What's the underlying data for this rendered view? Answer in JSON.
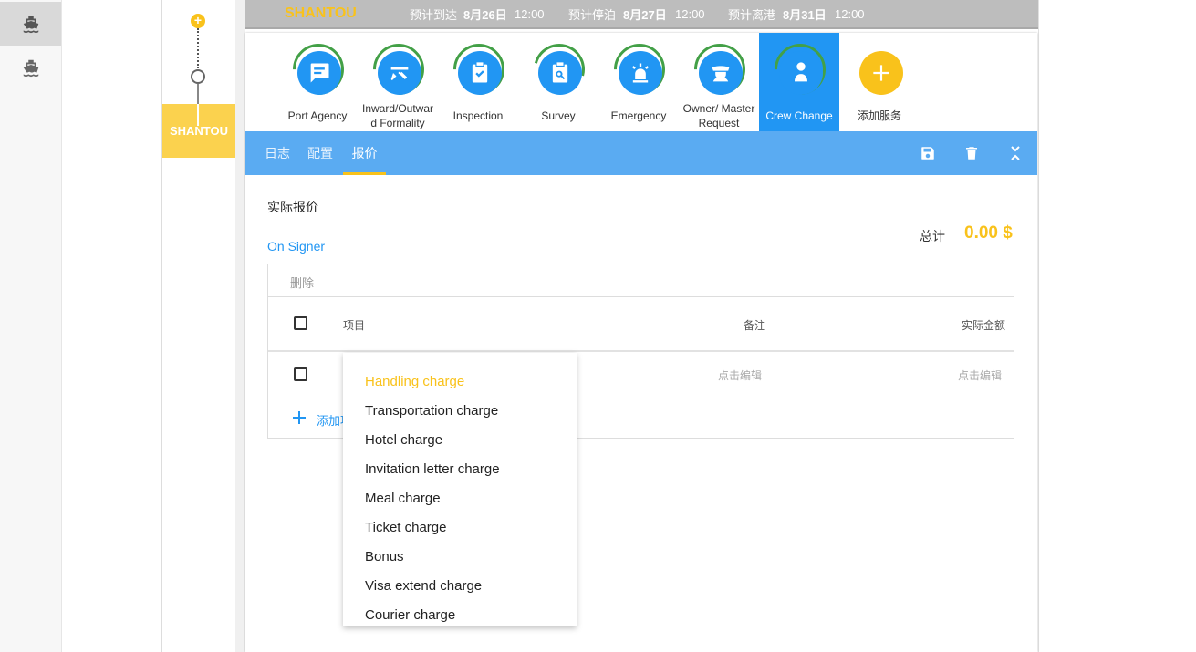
{
  "port_name": "SHANTOU",
  "eta": {
    "label": "预计到达",
    "date": "8月26日",
    "time": "12:00"
  },
  "etb": {
    "label": "预计停泊",
    "date": "8月27日",
    "time": "12:00"
  },
  "etd": {
    "label": "预计离港",
    "date": "8月31日",
    "time": "12:00"
  },
  "timeline_port": "SHANTOU",
  "services": [
    {
      "label": "Port Agency",
      "icon": "chat-list-icon"
    },
    {
      "label": "Inward/Outward Formality",
      "label_l1": "Inward/Outwar",
      "label_l2": "d Formality",
      "icon": "tools-icon"
    },
    {
      "label": "Inspection",
      "icon": "clipboard-check-icon"
    },
    {
      "label": "Survey",
      "icon": "clipboard-search-icon"
    },
    {
      "label": "Emergency",
      "icon": "siren-icon"
    },
    {
      "label": "Owner/ Master Request",
      "label_l1": "Owner/ Master",
      "label_l2": "Request",
      "icon": "captain-icon"
    },
    {
      "label": "Crew Change",
      "icon": "crew-change-icon"
    },
    {
      "label": "添加服务",
      "icon": "plus-icon"
    }
  ],
  "tabs": [
    "日志",
    "配置",
    "报价"
  ],
  "active_tab": "报价",
  "colors": {
    "primary": "#2196f3",
    "tabbar": "#5aabf2",
    "accent": "#f9c21b",
    "ring": "#43a047"
  },
  "quote": {
    "title": "实际报价",
    "total_label": "总计",
    "total_value": "0.00 $",
    "section": "On Signer",
    "delete_label": "删除",
    "col_item": "项目",
    "col_remark": "备注",
    "col_amount": "实际金额",
    "edit_placeholder": "点击编辑",
    "add_label": "添加项"
  },
  "dropdown": [
    "Handling charge",
    "Transportation charge",
    "Hotel charge",
    "Invitation letter charge",
    "Meal charge",
    "Ticket charge",
    "Bonus",
    "Visa extend charge",
    "Courier charge"
  ]
}
